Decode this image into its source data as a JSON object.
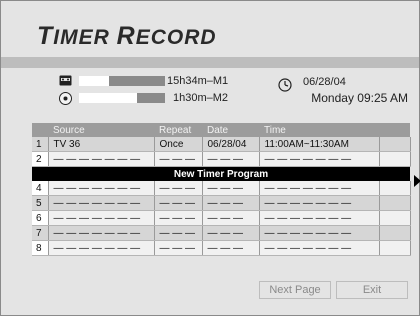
{
  "header": {
    "title_first_letter": "T",
    "title_rest": "IMER ",
    "title_second_letter": "R",
    "title_end": "ECORD"
  },
  "media": [
    {
      "icon": "cassette-icon",
      "remaining": "15h34m–M1",
      "level": 0.6
    },
    {
      "icon": "disc-icon",
      "remaining": "1h30m–M2",
      "level": 0.7
    }
  ],
  "clock": {
    "icon": "clock-icon",
    "date": "06/28/04",
    "day_time": "Monday  09:25 AM"
  },
  "table": {
    "headers": [
      "",
      "Source",
      "Repeat",
      "Date",
      "Time",
      ""
    ],
    "rows": [
      {
        "index": "1",
        "source": "TV 36",
        "repeat": "Once",
        "date": "06/28/04",
        "time": "11:00AM~11:30AM"
      },
      {
        "index": "2",
        "source": "— — — — — — —",
        "repeat": "— — —",
        "date": "— — —",
        "time": "— — — — — — —"
      },
      {
        "index": "4",
        "source": "— — — — — — —",
        "repeat": "— — —",
        "date": "— — —",
        "time": "— — — — — — —"
      },
      {
        "index": "5",
        "source": "— — — — — — —",
        "repeat": "— — —",
        "date": "— — —",
        "time": "— — — — — — —"
      },
      {
        "index": "6",
        "source": "— — — — — — —",
        "repeat": "— — —",
        "date": "— — —",
        "time": "— — — — — — —"
      },
      {
        "index": "7",
        "source": "— — — — — — —",
        "repeat": "— — —",
        "date": "— — —",
        "time": "— — — — — — —"
      },
      {
        "index": "8",
        "source": "— — — — — — —",
        "repeat": "— — —",
        "date": "— — —",
        "time": "— — — — — — —"
      }
    ],
    "new_program_label": "New Timer Program"
  },
  "buttons": {
    "next_page": "Next Page",
    "exit": "Exit"
  },
  "colors": {
    "background": "#e4e4e4",
    "header_row": "#9c9c9c",
    "highlight": "#000000"
  }
}
